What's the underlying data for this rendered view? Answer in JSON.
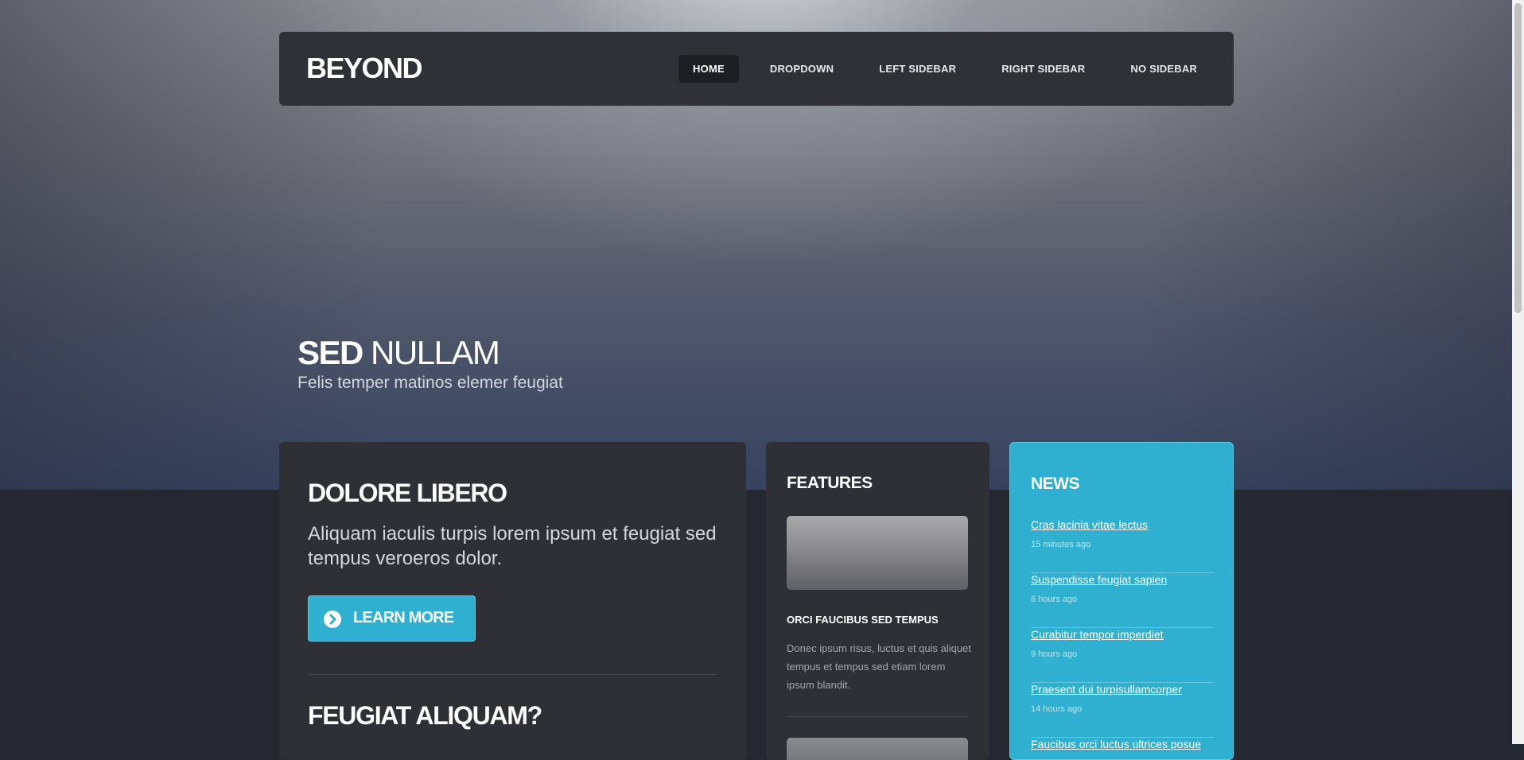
{
  "site": {
    "logo": "BEYOND"
  },
  "nav": {
    "items": [
      {
        "label": "HOME",
        "active": true
      },
      {
        "label": "DROPDOWN",
        "active": false
      },
      {
        "label": "LEFT SIDEBAR",
        "active": false
      },
      {
        "label": "RIGHT SIDEBAR",
        "active": false
      },
      {
        "label": "NO SIDEBAR",
        "active": false
      }
    ]
  },
  "hero": {
    "title_bold": "SED",
    "title_light": "NULLAM",
    "subtitle": "Felis temper matinos elemer feugiat"
  },
  "main": {
    "heading": "DOLORE LIBERO",
    "text": "Aliquam iaculis turpis lorem ipsum et feugiat sed tempus veroeros dolor.",
    "button_label": "LEARN MORE",
    "heading2": "FEUGIAT ALIQUAM?"
  },
  "features": {
    "heading": "FEATURES",
    "item_title": "ORCI FAUCIBUS SED TEMPUS",
    "item_text": "Donec ipsum risus, luctus et quis aliquet tempus et tempus sed etiam lorem ipsum blandit."
  },
  "news": {
    "heading": "NEWS",
    "items": [
      {
        "title": "Cras lacinia vitae lectus",
        "time": "15 minutes ago"
      },
      {
        "title": "Suspendisse feugiat sapien",
        "time": "6 hours ago"
      },
      {
        "title": "Curabitur tempor imperdiet",
        "time": "9 hours ago"
      },
      {
        "title": "Praesent dui turpisullamcorper",
        "time": "14 hours ago"
      },
      {
        "title": "Faucibus orci luctus ultrices posue",
        "time": ""
      }
    ]
  },
  "colors": {
    "accent": "#2fb0d0",
    "panel": "#2e3036",
    "page_bg": "#252830"
  }
}
